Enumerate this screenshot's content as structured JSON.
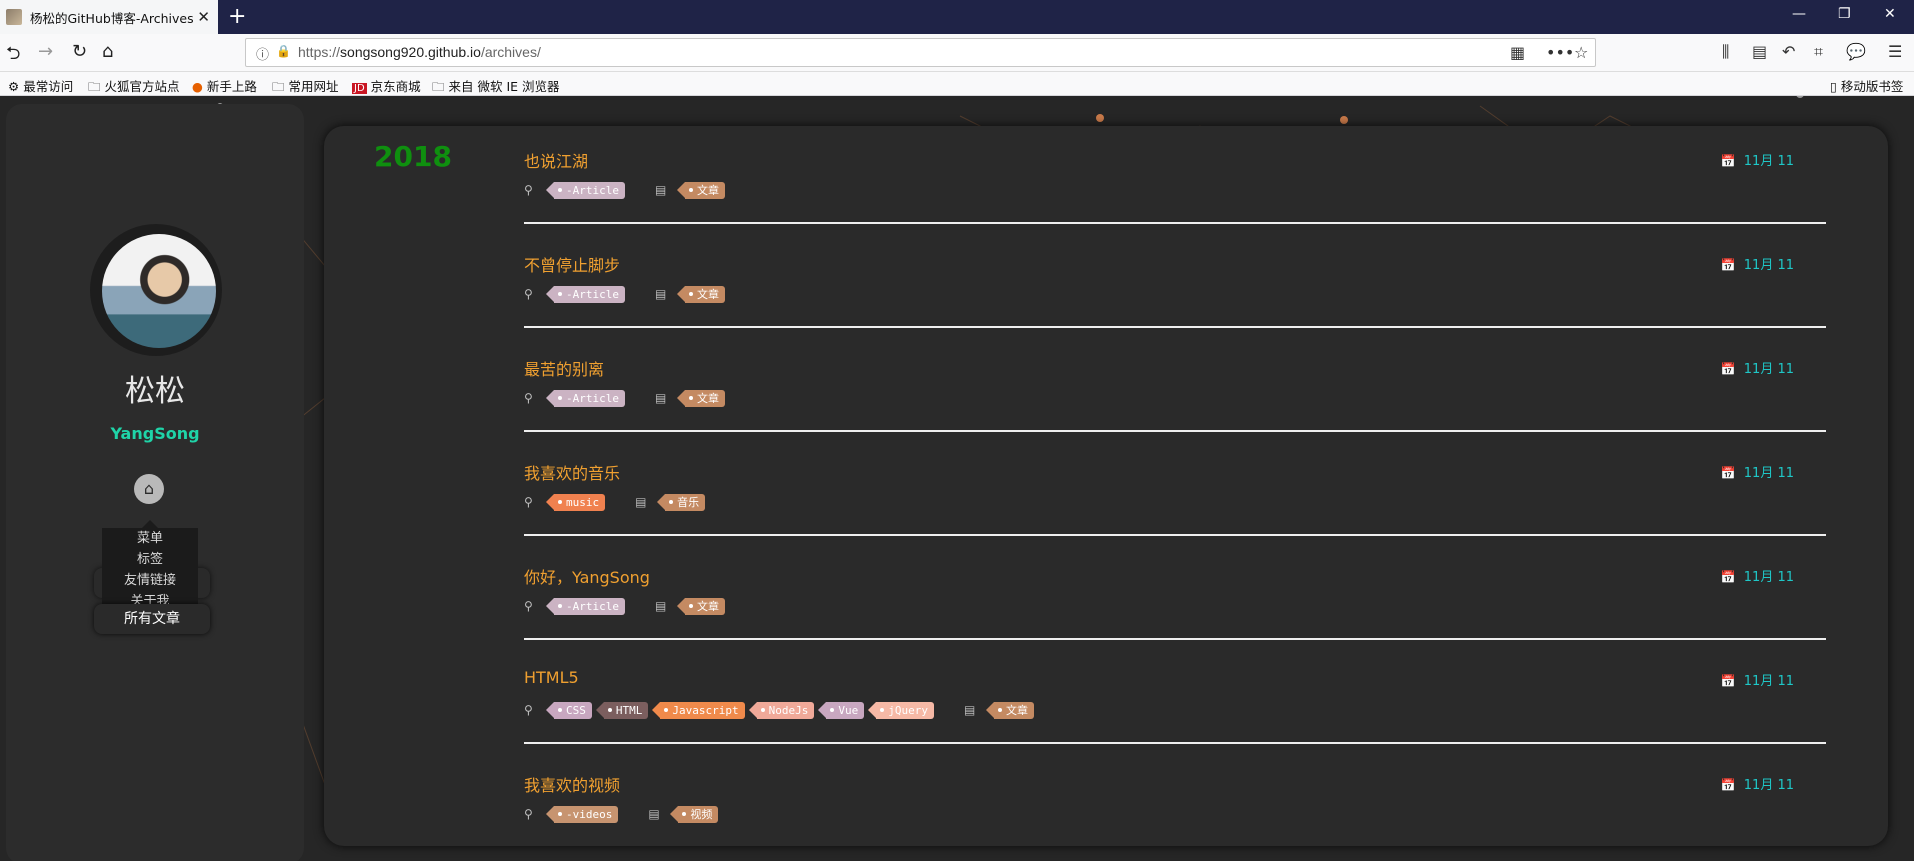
{
  "browser": {
    "tab_title": "杨松的GitHub博客-Archives |",
    "url_scheme": "https://",
    "url_domain": "songsong920.github.io",
    "url_path": "/archives/",
    "bookmarks": [
      "最常访问",
      "火狐官方站点",
      "新手上路",
      "常用网址",
      "京东商城",
      "来自 微软 IE 浏览器"
    ],
    "mobile_bookmarks": "移动版书签"
  },
  "sidebar": {
    "name": "松松",
    "subtitle": "YangSong",
    "menu": [
      "菜单",
      "标签",
      "友情链接",
      "关于我"
    ],
    "all_posts": "所有文章"
  },
  "archive": {
    "year": "2018",
    "posts": [
      {
        "title": "也说江湖",
        "date": "11月 11",
        "tags": [
          {
            "t": "-Article",
            "c": "#cbb3c3"
          }
        ],
        "cat": "文章"
      },
      {
        "title": "不曾停止脚步",
        "date": "11月 11",
        "tags": [
          {
            "t": "-Article",
            "c": "#cbb3c3"
          }
        ],
        "cat": "文章"
      },
      {
        "title": "最苦的别离",
        "date": "11月 11",
        "tags": [
          {
            "t": "-Article",
            "c": "#cbb3c3"
          }
        ],
        "cat": "文章"
      },
      {
        "title": "我喜欢的音乐",
        "date": "11月 11",
        "tags": [
          {
            "t": "music",
            "c": "#f0814f"
          }
        ],
        "cat": "音乐"
      },
      {
        "title": "你好，YangSong",
        "date": "11月 11",
        "tags": [
          {
            "t": "-Article",
            "c": "#cbb3c3"
          }
        ],
        "cat": "文章"
      },
      {
        "title": "HTML5",
        "date": "11月 11",
        "tags": [
          {
            "t": "CSS",
            "c": "#c8a7c0"
          },
          {
            "t": "HTML",
            "c": "#7b5e5e"
          },
          {
            "t": "Javascript",
            "c": "#f08a4b"
          },
          {
            "t": "NodeJs",
            "c": "#f0a999"
          },
          {
            "t": "Vue",
            "c": "#c8a7c0"
          },
          {
            "t": "jQuery",
            "c": "#f6b9a6"
          }
        ],
        "cat": "文章"
      },
      {
        "title": "我喜欢的视频",
        "date": "11月 11",
        "tags": [
          {
            "t": "-videos",
            "c": "#c79470"
          }
        ],
        "cat": "视频"
      }
    ]
  },
  "colors": {
    "accent_title": "#f0a030",
    "date": "#1fc7c7",
    "year": "#0f8f0f",
    "cat_tag": "#c48a62"
  }
}
